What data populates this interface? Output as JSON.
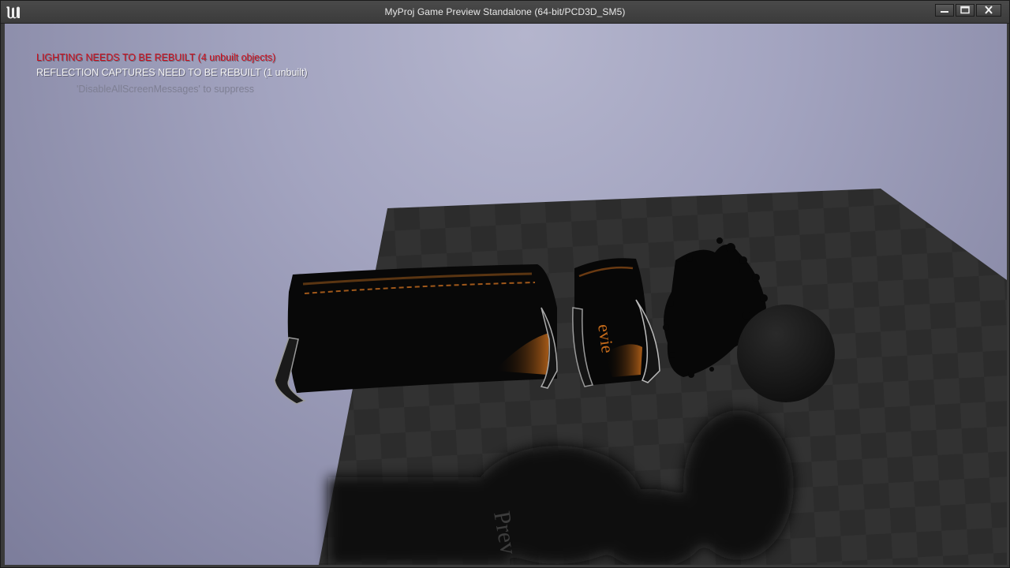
{
  "window": {
    "title": "MyProj Game Preview Standalone (64-bit/PCD3D_SM5)"
  },
  "window_controls": {
    "minimize_icon": "minimize-icon",
    "maximize_icon": "maximize-icon",
    "close_icon": "close-icon"
  },
  "messages": {
    "lighting": "LIGHTING NEEDS TO BE REBUILT (4 unbuilt objects)",
    "reflection": "REFLECTION CAPTURES NEED TO BE REBUILT (1 unbuilt)",
    "suppress": "'DisableAllScreenMessages' to suppress"
  },
  "scene": {
    "chair_brand": "evie",
    "floor_text": "Prev"
  },
  "colors": {
    "error_text": "#d0101e",
    "sky": "#a3a4c0",
    "floor": "#2b2b2b",
    "leather": "#c46a1a"
  }
}
